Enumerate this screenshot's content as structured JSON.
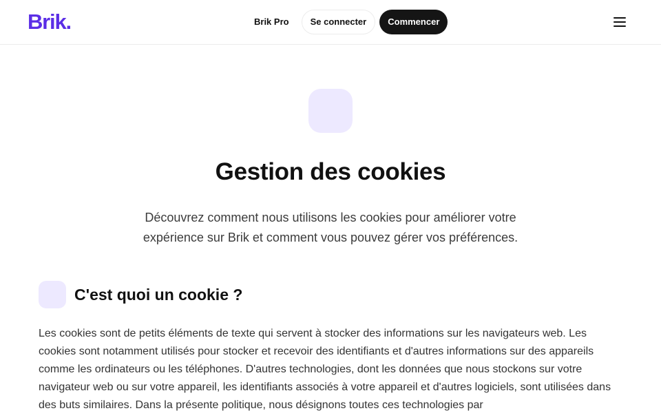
{
  "header": {
    "logo": "Brik.",
    "nav": {
      "pro_label": "Brik Pro",
      "login_label": "Se connecter",
      "start_label": "Commencer"
    },
    "menu_icon": "hamburger-menu-icon"
  },
  "hero": {
    "icon": "cookie-icon",
    "title": "Gestion des cookies",
    "subtitle": "Découvrez comment nous utilisons les cookies pour améliorer votre expérience sur Brik et comment vous pouvez gérer vos préférences."
  },
  "section": {
    "icon": "info-icon",
    "title": "C'est quoi un cookie ?",
    "body": "Les cookies sont de petits éléments de texte qui servent à stocker des informations sur les navigateurs web. Les cookies sont notamment utilisés pour stocker et recevoir des identifiants et d'autres informations sur des appareils comme les ordinateurs ou les téléphones. D'autres technologies, dont les données que nous stockons sur votre navigateur web ou sur votre appareil, les identifiants associés à votre appareil et d'autres logiciels, sont utilisées dans des buts similaires. Dans la présente politique, nous désignons toutes ces technologies par"
  },
  "colors": {
    "brand": "#5b2ee6",
    "icon_tint": "#ede9ff",
    "dark_button": "#151515"
  }
}
